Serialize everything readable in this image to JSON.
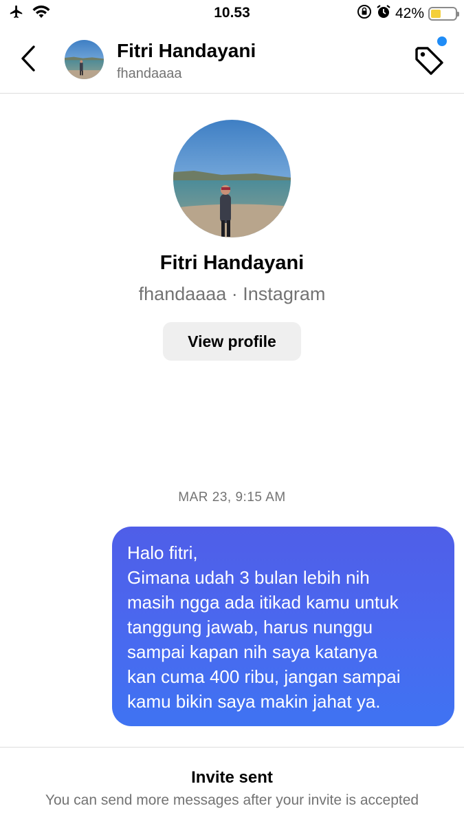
{
  "status_bar": {
    "time": "10.53",
    "battery_percent": "42%",
    "battery_level": 0.42,
    "icons": [
      "airplane-icon",
      "wifi-icon",
      "rotation-lock-icon",
      "alarm-icon",
      "battery-icon"
    ]
  },
  "header": {
    "name": "Fitri Handayani",
    "username": "fhandaaaa",
    "back_icon": "chevron-left-icon",
    "tag_icon": "tag-icon",
    "notification_dot_color": "#1f8cf6"
  },
  "profile": {
    "name": "Fitri Handayani",
    "subtitle": "fhandaaaa · Instagram",
    "view_profile_label": "View profile"
  },
  "conversation": {
    "timestamp": "MAR 23, 9:15 AM",
    "message_lines": [
      "Halo fitri,",
      "Gimana udah 3 bulan lebih nih",
      "masih ngga ada itikad kamu untuk",
      "tanggung jawab, harus nunggu",
      "sampai kapan nih saya katanya",
      "kan cuma 400 ribu, jangan sampai",
      "kamu bikin saya makin jahat ya."
    ],
    "bubble_color": "#4a68ef"
  },
  "footer": {
    "title": "Invite sent",
    "subtitle": "You can send more messages after your invite is accepted"
  }
}
